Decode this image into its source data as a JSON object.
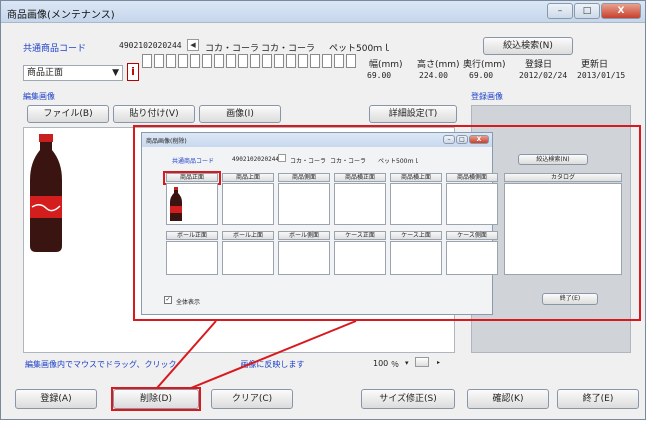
{
  "window": {
    "title": "商品画像(メンテナンス)",
    "controls": {
      "minimize": "–",
      "maximize": "□",
      "close": "X"
    }
  },
  "product": {
    "code_label": "共通商品コード",
    "code_value": "4902102020244",
    "maker_name": "コカ・コーラ",
    "product_name": "コカ・コーラ",
    "spec": "ペット500ｍｌ",
    "search_button": "絞込検索(N)"
  },
  "image_type": {
    "selected": "商品正面",
    "dimension_headers": {
      "width": "幅(mm)",
      "height": "高さ(mm)",
      "depth": "奥行(mm)",
      "registered": "登録日",
      "updated": "更新日"
    },
    "dimension_values": {
      "width": "69.00",
      "height": "224.00",
      "depth": "69.00",
      "registered": "2012/02/24",
      "updated": "2013/01/15"
    }
  },
  "editing": {
    "label": "編集画像",
    "registered_label": "登録画像",
    "buttons": {
      "file": "ファイル(B)",
      "paste": "貼り付け(V)",
      "image": "画像(I)",
      "detail": "詳細設定(T)"
    },
    "hint": "編集画像内でマウスでドラッグ、クリック　　　　　　　　画像に反映します",
    "zoom": "100",
    "zoom_unit": "％"
  },
  "footer": {
    "register": "登録(A)",
    "delete": "削除(D)",
    "clear": "クリア(C)",
    "size_fix": "サイズ修正(S)",
    "confirm": "確認(K)",
    "exit": "終了(E)"
  },
  "dialog": {
    "title": "商品画像(削除)",
    "code_label": "共通商品コード",
    "code_value": "4902102020244",
    "maker_name": "コカ・コーラ",
    "product_name": "コカ・コーラ",
    "spec": "ペット500ｍｌ",
    "search_button": "絞込検索(N)",
    "row1_headers": [
      "商品正面",
      "商品上面",
      "商品側面",
      "商品横正面",
      "商品横上面",
      "商品横側面"
    ],
    "catalog_header": "カタログ",
    "row2_headers": [
      "ボール正面",
      "ボール上面",
      "ボール側面",
      "ケース正面",
      "ケース上面",
      "ケース側面"
    ],
    "show_all": "全体表示",
    "exit_button": "終了(E)"
  },
  "colors": {
    "highlight": "#d8191e",
    "label_blue": "#1e40c8"
  }
}
